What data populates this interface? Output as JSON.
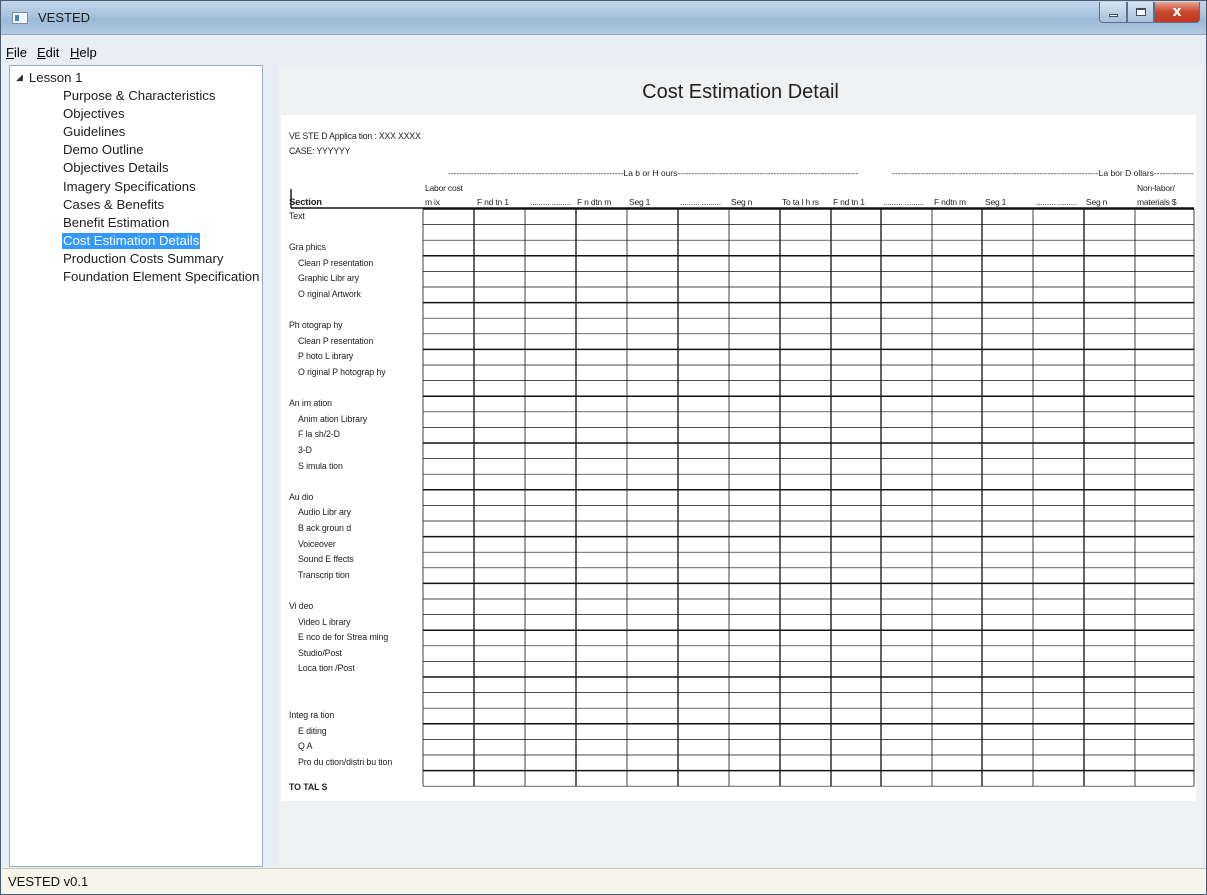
{
  "window": {
    "title": "VESTED",
    "controls": {
      "minimize": "minimize-icon",
      "maximize": "maximize-icon",
      "close": "close-icon",
      "close_glyph": "x"
    }
  },
  "menu": [
    {
      "accel": "F",
      "rest": "ile"
    },
    {
      "accel": "E",
      "rest": "dit"
    },
    {
      "accel": "H",
      "rest": "elp"
    }
  ],
  "sidebar": {
    "root": {
      "label": "Lesson 1",
      "expanded_icon": "triangle-down-icon"
    },
    "items": [
      {
        "label": "Purpose & Characteristics",
        "selected": false
      },
      {
        "label": "Objectives",
        "selected": false
      },
      {
        "label": "Guidelines",
        "selected": false
      },
      {
        "label": "Demo Outline",
        "selected": false
      },
      {
        "label": "Objectives Details",
        "selected": false
      },
      {
        "label": "Imagery Specifications",
        "selected": false
      },
      {
        "label": "Cases & Benefits",
        "selected": false
      },
      {
        "label": "Benefit Estimation",
        "selected": false
      },
      {
        "label": "Cost Estimation Details",
        "selected": true
      },
      {
        "label": "Production Costs Summary",
        "selected": false
      },
      {
        "label": "Foundation Element Specification",
        "selected": false
      }
    ]
  },
  "page": {
    "title": "Cost Estimation Detail",
    "application_line": "VE STE D Applica tion : XXX XXXX",
    "case_line": "CASE: YYYYYY",
    "group_headers": {
      "labor_hours": "--------------------------------------------------------------La b or H ours----------------------------------------------------------------",
      "labor_dollars": "-------------------------------------------------------------------------La bor D ollars---------------------------"
    },
    "columns": [
      {
        "line1": "Section",
        "line2": "",
        "bold": true
      },
      {
        "line1": "Labor cost",
        "line2": "m ix"
      },
      {
        "line1": "",
        "line2": "F nd tn 1"
      },
      {
        "line1": "",
        "line2": "......... ........."
      },
      {
        "line1": "",
        "line2": "F n dtn m"
      },
      {
        "line1": "",
        "line2": "Seg 1"
      },
      {
        "line1": "",
        "line2": "......... ........."
      },
      {
        "line1": "",
        "line2": "Seg n"
      },
      {
        "line1": "",
        "line2": "To ta l h rs"
      },
      {
        "line1": "",
        "line2": "F nd tn 1"
      },
      {
        "line1": "",
        "line2": "......... ........."
      },
      {
        "line1": "",
        "line2": "F ndtn m"
      },
      {
        "line1": "",
        "line2": "Seg 1"
      },
      {
        "line1": "",
        "line2": "......... ........."
      },
      {
        "line1": "",
        "line2": "Seg n"
      },
      {
        "line1": "Non-labor/",
        "line2": "materials $"
      }
    ],
    "rows": [
      {
        "label": "Text",
        "indent": false
      },
      {
        "label": "",
        "indent": false
      },
      {
        "label": "Gra phics",
        "indent": false
      },
      {
        "label": "Clean P resentation",
        "indent": true
      },
      {
        "label": "Graphic Libr ary",
        "indent": true
      },
      {
        "label": "O riginal Artwork",
        "indent": true
      },
      {
        "label": "",
        "indent": false
      },
      {
        "label": "Ph otograp hy",
        "indent": false
      },
      {
        "label": "Clean P resentation",
        "indent": true
      },
      {
        "label": "P hoto L ibrary",
        "indent": true
      },
      {
        "label": "O riginal P hotograp hy",
        "indent": true
      },
      {
        "label": "",
        "indent": false
      },
      {
        "label": "An im ation",
        "indent": false
      },
      {
        "label": "Anim ation Library",
        "indent": true
      },
      {
        "label": "F la sh/2-D",
        "indent": true
      },
      {
        "label": "3-D",
        "indent": true
      },
      {
        "label": "S imula tion",
        "indent": true
      },
      {
        "label": "",
        "indent": false
      },
      {
        "label": "Au dio",
        "indent": false
      },
      {
        "label": "Audio Libr ary",
        "indent": true
      },
      {
        "label": "B ack groun d",
        "indent": true
      },
      {
        "label": "Voiceover",
        "indent": true
      },
      {
        "label": "Sound E ffects",
        "indent": true
      },
      {
        "label": "Transcrip tion",
        "indent": true
      },
      {
        "label": "",
        "indent": false
      },
      {
        "label": "Vi deo",
        "indent": false
      },
      {
        "label": "Video L ibrary",
        "indent": true
      },
      {
        "label": "E nco de for Strea ming",
        "indent": true
      },
      {
        "label": "Studio/Post",
        "indent": true
      },
      {
        "label": "Loca tion /Post",
        "indent": true
      },
      {
        "label": "",
        "indent": false
      },
      {
        "label": "",
        "indent": false
      },
      {
        "label": "Integ ra tion",
        "indent": false
      },
      {
        "label": "E diting",
        "indent": true
      },
      {
        "label": "Q A",
        "indent": true
      },
      {
        "label": "Pro du ction/distri bu tion",
        "indent": true
      },
      {
        "label": "",
        "indent": false
      }
    ],
    "totals_label": "TO TAL S"
  },
  "status": {
    "text": "VESTED v0.1"
  }
}
